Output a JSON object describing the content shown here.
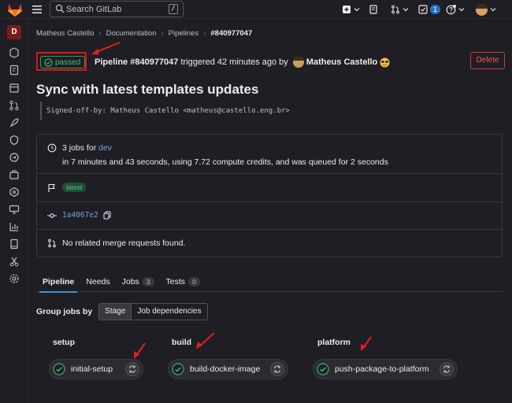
{
  "topbar": {
    "search_placeholder": "Search GitLab",
    "search_shortcut": "/",
    "todo_count": "1"
  },
  "sidebar": {
    "project_initial": "D"
  },
  "breadcrumb": {
    "items": [
      "Matheus Castello",
      "Documentation",
      "Pipelines",
      "#840977047"
    ]
  },
  "header": {
    "status": "passed",
    "pipeline_label": "Pipeline #840977047",
    "triggered_text": "triggered 42 minutes ago by",
    "author": "Matheus Castello",
    "delete_label": "Delete"
  },
  "commit": {
    "title": "Sync with latest templates updates",
    "message": "Signed-off-by: Matheus Castello <matheus@castello.eng.br>"
  },
  "info": {
    "jobs_prefix": "3 jobs for",
    "branch": "dev",
    "duration_text": "in 7 minutes and 43 seconds, using 7.72 compute credits, and was queued for 2 seconds",
    "tag": "latest",
    "sha": "1a4067e2",
    "mr_text": "No related merge requests found."
  },
  "tabs": [
    {
      "label": "Pipeline",
      "count": ""
    },
    {
      "label": "Needs",
      "count": ""
    },
    {
      "label": "Jobs",
      "count": "3"
    },
    {
      "label": "Tests",
      "count": "0"
    }
  ],
  "groupby": {
    "label": "Group jobs by",
    "options": [
      "Stage",
      "Job dependencies"
    ],
    "selected": "Stage"
  },
  "stages": [
    {
      "name": "setup",
      "job": "initial-setup"
    },
    {
      "name": "build",
      "job": "build-docker-image"
    },
    {
      "name": "platform",
      "job": "push-package-to-platform"
    }
  ],
  "colors": {
    "success": "#2da160",
    "link": "#63a6e9",
    "danger": "#d91616"
  }
}
